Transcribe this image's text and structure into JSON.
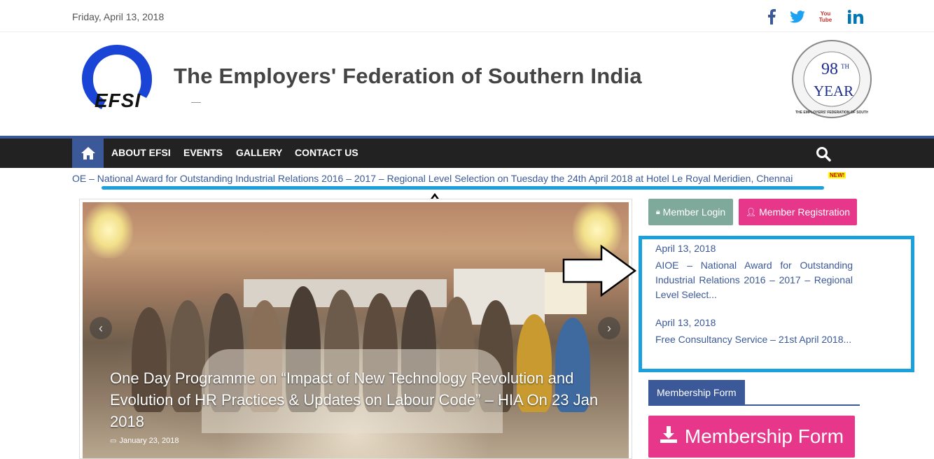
{
  "topbar": {
    "date": "Friday, April 13, 2018",
    "social": [
      "facebook-icon",
      "twitter-icon",
      "youtube-icon",
      "linkedin-icon"
    ],
    "youtube_label": "You Tube"
  },
  "header": {
    "logo_text": "EFSI",
    "site_title": "The Employers' Federation of Southern India",
    "badge": {
      "number": "98",
      "suffix": "TH",
      "word": "YEAR",
      "ring_text": "THE EMPLOYERS' FEDERATION OF SOUTHERN INDIA"
    }
  },
  "nav": {
    "home_icon": "home-icon",
    "items": [
      "ABOUT EFSI",
      "EVENTS",
      "GALLERY",
      "CONTACT US"
    ],
    "search_icon": "search-icon"
  },
  "ticker": {
    "text": "OE – National Award for Outstanding Industrial Relations 2016 – 2017 – Regional Level Selection on Tuesday the 24th April 2018 at Hotel Le Royal Meridien, Chennai",
    "new_badge": "NEW!"
  },
  "slider": {
    "caption": "One Day Programme on “Impact of New Technology Revolution and Evolution of HR Practices & Updates on Labour Code” – HIA On 23 Jan 2018",
    "date": "January 23, 2018",
    "prev_icon": "chevron-left-icon",
    "next_icon": "chevron-right-icon"
  },
  "sidebar": {
    "login_label": "Member Login",
    "register_label": "Member Registration",
    "news": [
      {
        "date": "April 13, 2018",
        "text": "AIOE – National Award for Outstanding Industrial Relations 2016 – 2017 – Regional Level Select..."
      },
      {
        "date": "April 13, 2018",
        "text": "Free Consultancy Service – 21st April 2018..."
      }
    ],
    "widget_title": "Membership Form",
    "membership_button": "Membership Form"
  },
  "colors": {
    "brand_blue": "#3b5998",
    "pink": "#e6378a",
    "green_gray": "#7fa99b",
    "highlight": "#1aa0dc",
    "nav_bg": "#222222"
  }
}
